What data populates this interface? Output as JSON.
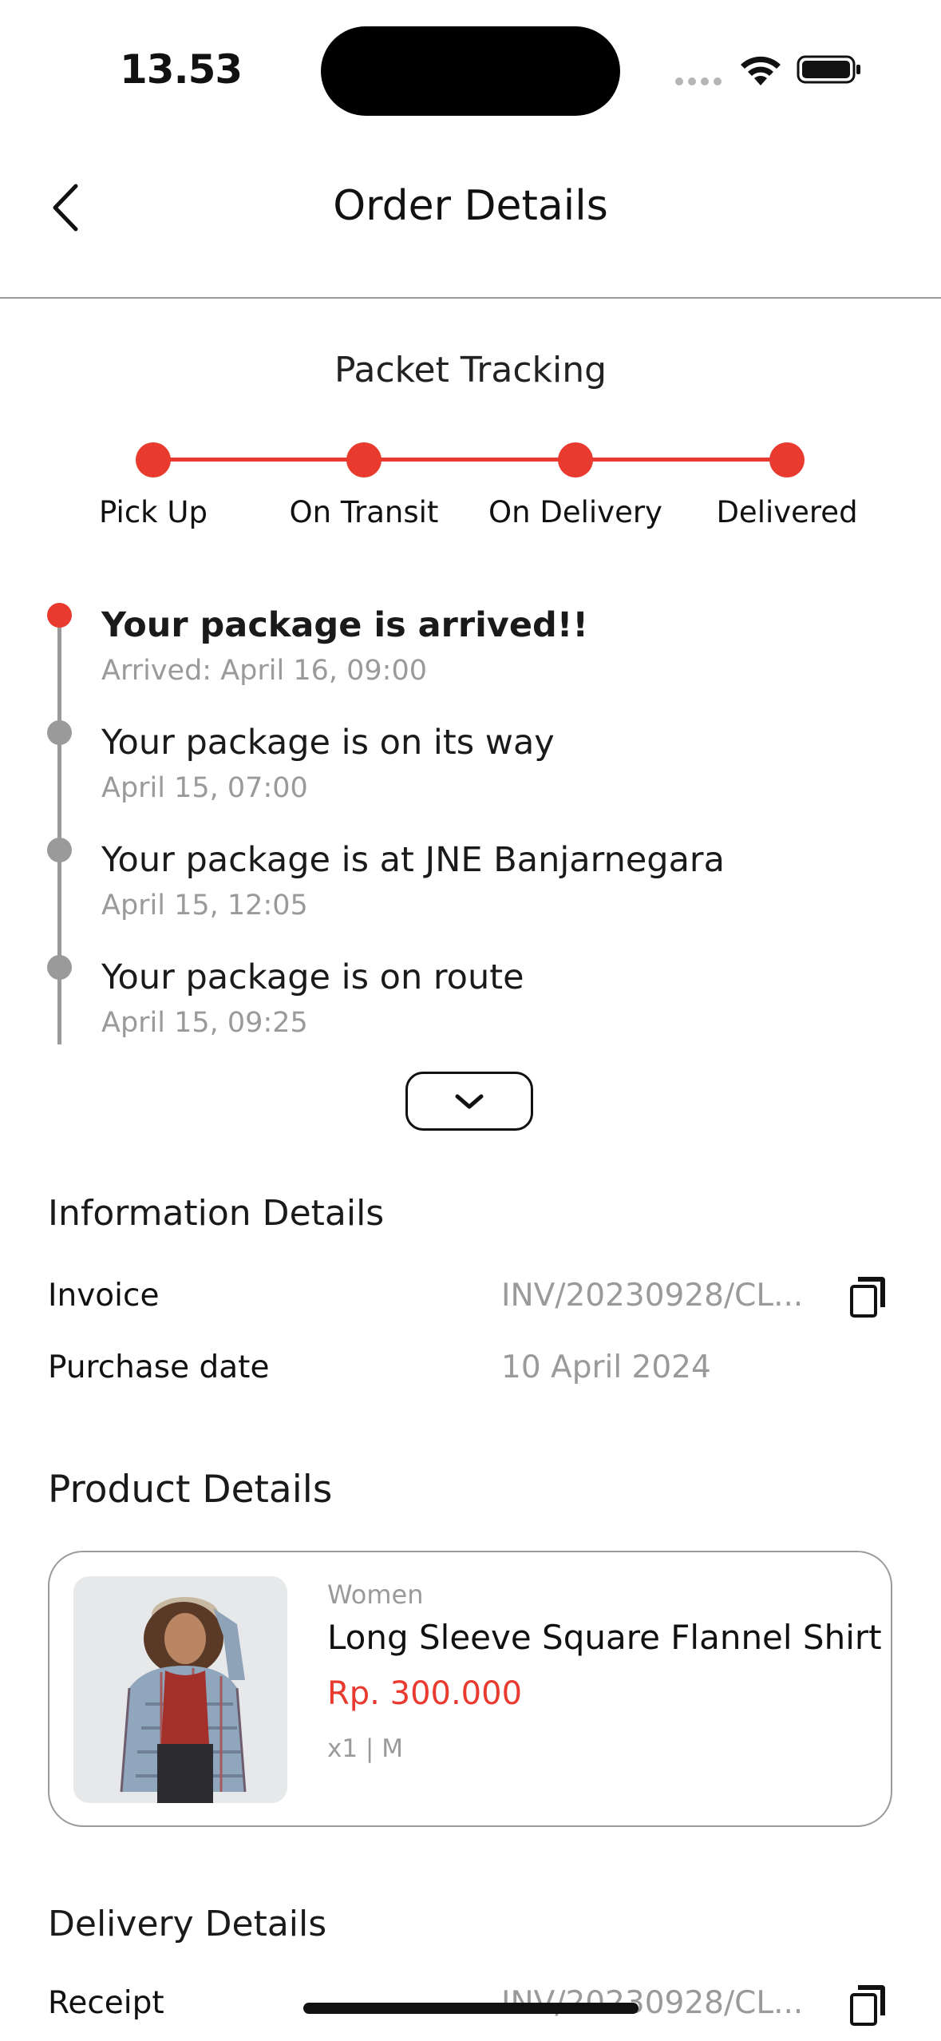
{
  "status_bar": {
    "time": "13.53"
  },
  "header": {
    "title": "Order Details"
  },
  "tracking": {
    "title": "Packet Tracking",
    "steps": [
      "Pick Up",
      "On Transit",
      "On Delivery",
      "Delivered"
    ],
    "accent_color": "#e83a2f",
    "timeline": [
      {
        "title": "Your package is arrived!!",
        "time": "Arrived: April 16, 09:00"
      },
      {
        "title": "Your package is on its way",
        "time": "April 15, 07:00"
      },
      {
        "title": "Your package is at JNE Banjarnegara",
        "time": "April 15, 12:05"
      },
      {
        "title": "Your package is on route",
        "time": "April 15, 09:25"
      }
    ]
  },
  "information": {
    "title": "Information Details",
    "invoice_label": "Invoice",
    "invoice_value": "INV/20230928/CL...",
    "purchase_date_label": "Purchase date",
    "purchase_date_value": "10 April 2024"
  },
  "product": {
    "title": "Product Details",
    "category": "Women",
    "name": "Long Sleeve Square Flannel Shirt",
    "price": "Rp. 300.000",
    "qty_size": "x1 | M"
  },
  "delivery": {
    "title": "Delivery Details",
    "receipt_label": "Receipt",
    "receipt_value": "INV/20230928/CL..."
  }
}
